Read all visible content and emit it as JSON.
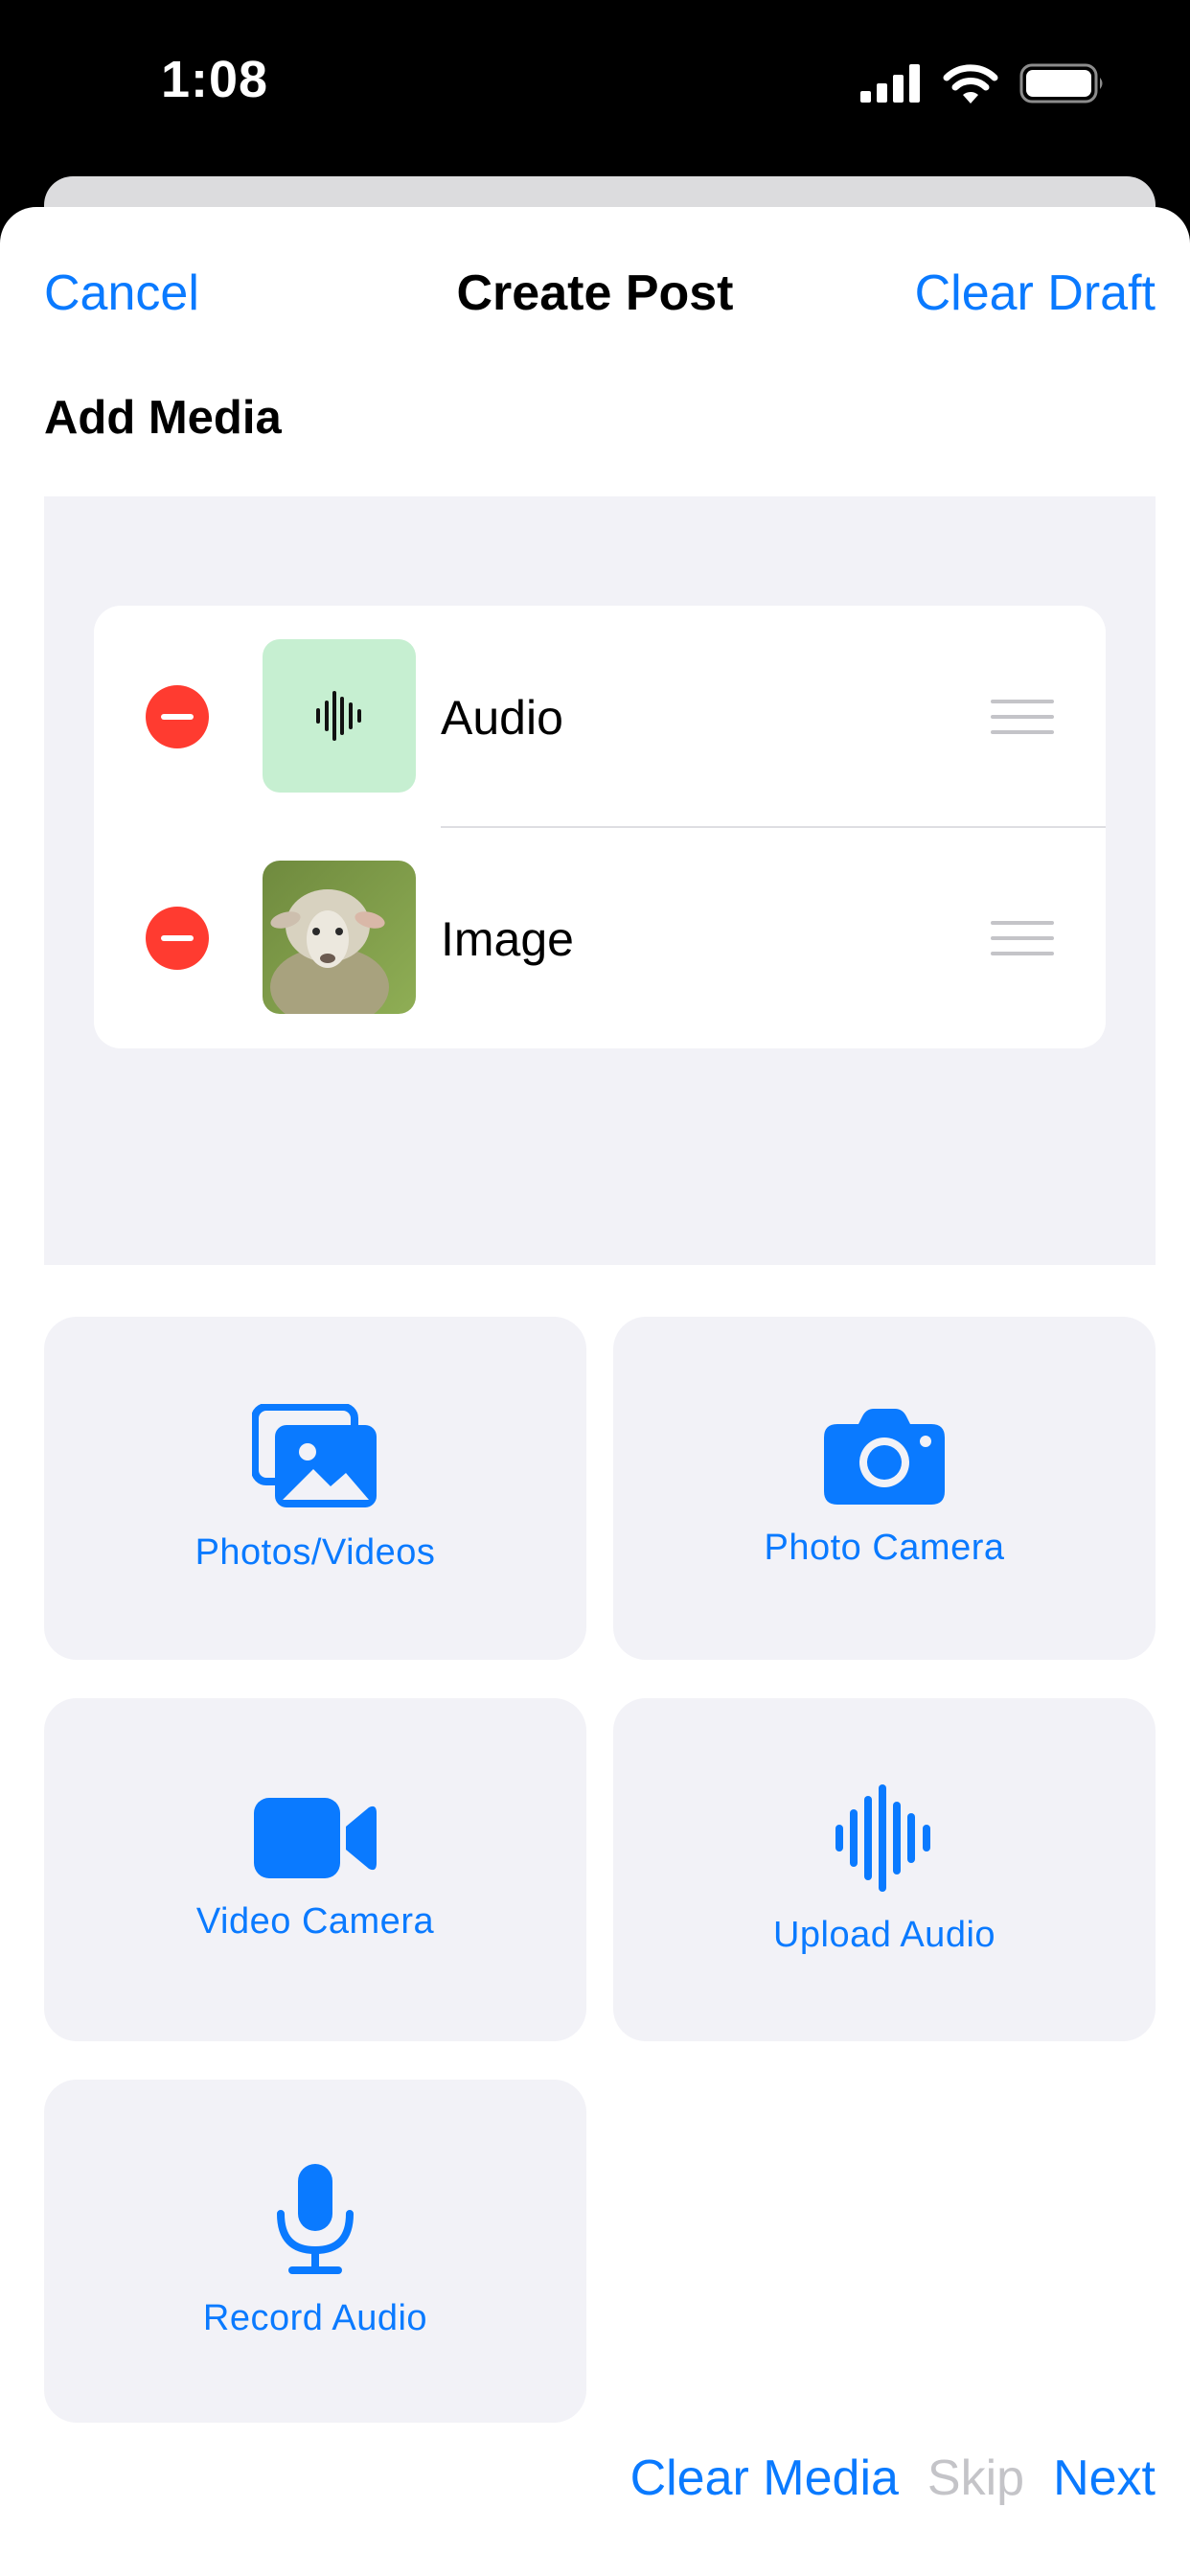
{
  "status_bar": {
    "time": "1:08"
  },
  "header": {
    "cancel_label": "Cancel",
    "title": "Create Post",
    "clear_draft_label": "Clear Draft"
  },
  "section": {
    "title": "Add Media"
  },
  "media_items": [
    {
      "label": "Audio",
      "type": "audio",
      "icon": "waveform-icon"
    },
    {
      "label": "Image",
      "type": "image",
      "icon": "sheep-photo"
    }
  ],
  "tiles": [
    {
      "label": "Photos/Videos",
      "icon": "photos-icon"
    },
    {
      "label": "Photo Camera",
      "icon": "camera-icon"
    },
    {
      "label": "Video Camera",
      "icon": "video-camera-icon"
    },
    {
      "label": "Upload Audio",
      "icon": "waveform-icon"
    },
    {
      "label": "Record Audio",
      "icon": "microphone-icon"
    }
  ],
  "footer": {
    "clear_media_label": "Clear Media",
    "skip_label": "Skip",
    "next_label": "Next"
  },
  "colors": {
    "accent": "#0a7aff",
    "destructive": "#ff3b30",
    "audio_thumb_bg": "#c6efd1",
    "grouped_bg": "#f2f2f7",
    "disabled": "#c4c4c8"
  }
}
